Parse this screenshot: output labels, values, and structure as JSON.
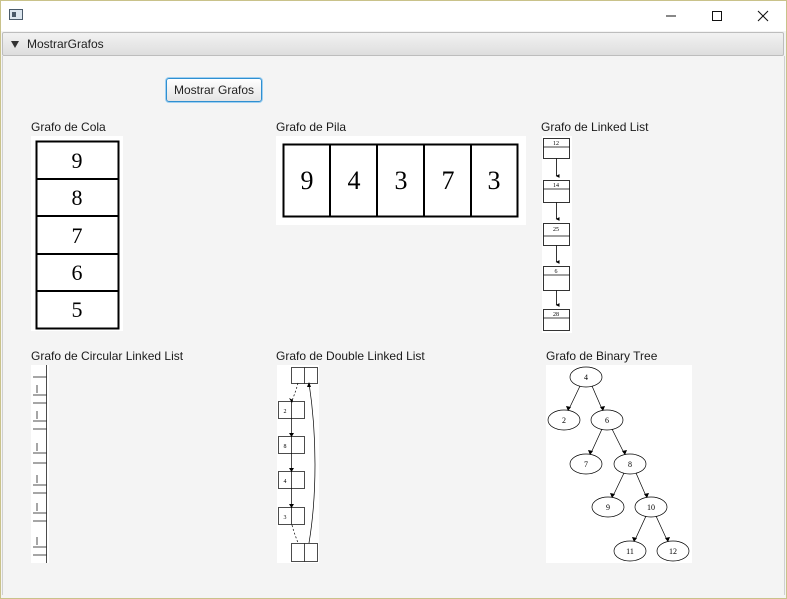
{
  "window": {
    "title": "",
    "minimize_icon": "minimize-icon",
    "maximize_icon": "maximize-icon",
    "close_icon": "close-icon"
  },
  "pane": {
    "title": "MostrarGrafos"
  },
  "actions": {
    "show_graphs_label": "Mostrar Grafos"
  },
  "graphs": {
    "cola": {
      "label": "Grafo de Cola",
      "values": [
        "9",
        "8",
        "7",
        "6",
        "5"
      ]
    },
    "pila": {
      "label": "Grafo de Pila",
      "values": [
        "9",
        "4",
        "3",
        "7",
        "3"
      ]
    },
    "linked": {
      "label": "Grafo de Linked List",
      "values": [
        "12",
        "14",
        "25",
        "6",
        "28"
      ]
    },
    "circular": {
      "label": "Grafo de Circular Linked List"
    },
    "double": {
      "label": "Grafo de Double Linked List",
      "values": [
        "2",
        "8",
        "4",
        "3"
      ]
    },
    "tree": {
      "label": "Grafo de Binary Tree",
      "values": [
        "4",
        "2",
        "6",
        "7",
        "8",
        "9",
        "10",
        "11",
        "12"
      ]
    }
  }
}
